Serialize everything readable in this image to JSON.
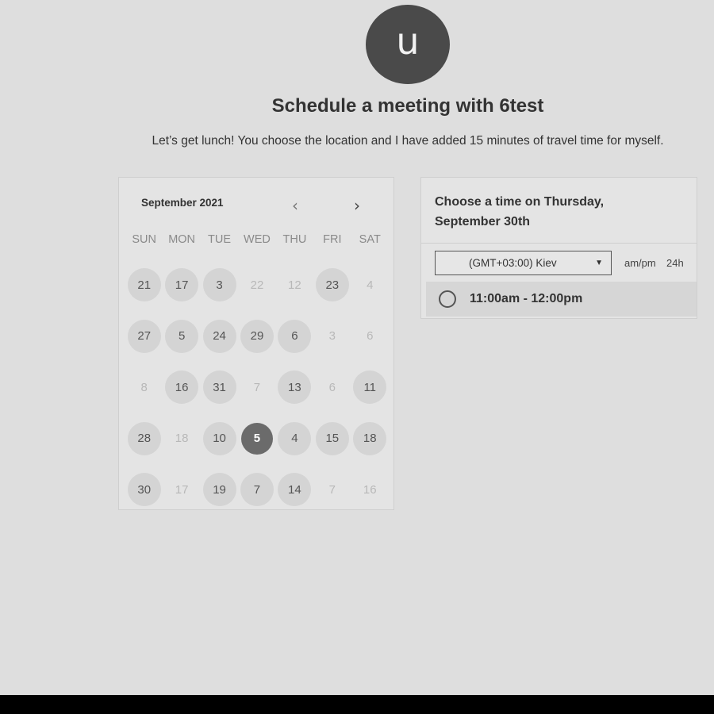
{
  "header": {
    "avatar_initial": "u",
    "title": "Schedule a meeting with 6test",
    "description": "Let’s get lunch! You choose the location and I have added 15 minutes of travel time for myself."
  },
  "calendar": {
    "month_label": "September 2021",
    "prev_icon": "chevron-left-icon",
    "next_icon": "chevron-right-icon",
    "weekdays": [
      "SUN",
      "MON",
      "TUE",
      "WED",
      "THU",
      "FRI",
      "SAT"
    ],
    "weeks": [
      [
        {
          "d": "21",
          "s": "available"
        },
        {
          "d": "17",
          "s": "available"
        },
        {
          "d": "3",
          "s": "available"
        },
        {
          "d": "22",
          "s": "disabled"
        },
        {
          "d": "12",
          "s": "disabled"
        },
        {
          "d": "23",
          "s": "available"
        },
        {
          "d": "4",
          "s": "disabled"
        }
      ],
      [
        {
          "d": "27",
          "s": "available"
        },
        {
          "d": "5",
          "s": "available"
        },
        {
          "d": "24",
          "s": "available"
        },
        {
          "d": "29",
          "s": "available"
        },
        {
          "d": "6",
          "s": "available"
        },
        {
          "d": "3",
          "s": "disabled"
        },
        {
          "d": "6",
          "s": "disabled"
        }
      ],
      [
        {
          "d": "8",
          "s": "disabled"
        },
        {
          "d": "16",
          "s": "available"
        },
        {
          "d": "31",
          "s": "available"
        },
        {
          "d": "7",
          "s": "disabled"
        },
        {
          "d": "13",
          "s": "available"
        },
        {
          "d": "6",
          "s": "disabled"
        },
        {
          "d": "11",
          "s": "available"
        }
      ],
      [
        {
          "d": "28",
          "s": "available"
        },
        {
          "d": "18",
          "s": "disabled"
        },
        {
          "d": "10",
          "s": "available"
        },
        {
          "d": "5",
          "s": "selected"
        },
        {
          "d": "4",
          "s": "available"
        },
        {
          "d": "15",
          "s": "available"
        },
        {
          "d": "18",
          "s": "available"
        }
      ],
      [
        {
          "d": "30",
          "s": "available"
        },
        {
          "d": "17",
          "s": "disabled"
        },
        {
          "d": "19",
          "s": "available"
        },
        {
          "d": "7",
          "s": "available"
        },
        {
          "d": "14",
          "s": "available"
        },
        {
          "d": "7",
          "s": "disabled"
        },
        {
          "d": "16",
          "s": "disabled"
        }
      ]
    ]
  },
  "time_panel": {
    "heading": "Choose a time on Thursday, September 30th",
    "timezone": "(GMT+03:00) Kiev",
    "format_ampm": "am/pm",
    "format_24h": "24h",
    "slots": [
      {
        "label": "11:00am - 12:00pm"
      }
    ]
  },
  "colors": {
    "background": "#dedede",
    "selected_day": "#6b6b6b",
    "avatar": "#4a4a4a"
  }
}
